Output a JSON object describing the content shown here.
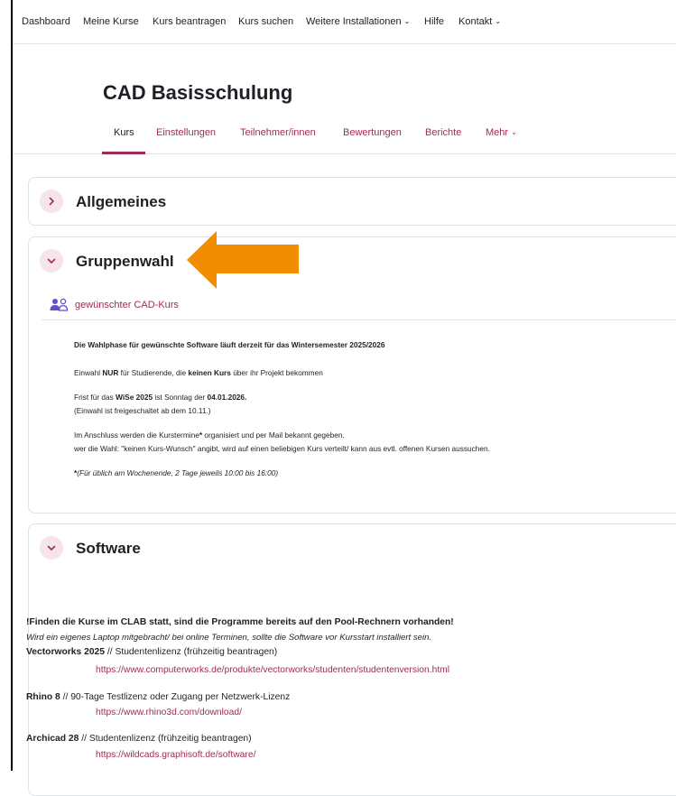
{
  "topnav": {
    "items": [
      "Dashboard",
      "Meine Kurse",
      "Kurs beantragen",
      "Kurs suchen",
      "Weitere Installationen",
      "Hilfe",
      "Kontakt"
    ]
  },
  "course": {
    "title": "CAD Basisschulung",
    "tabs": [
      "Kurs",
      "Einstellungen",
      "Teilnehmer/innen",
      "Bewertungen",
      "Berichte",
      "Mehr"
    ],
    "active_tab": "Kurs"
  },
  "sections": {
    "allgemeines": {
      "title": "Allgemeines",
      "state": "collapsed"
    },
    "gruppenwahl": {
      "title": "Gruppenwahl",
      "state": "expanded",
      "activity": {
        "label": "gewünschter CAD-Kurs",
        "icon": "group-choice-icon"
      },
      "heading": "Die Wahlphase für gewünschte Software läuft derzeit für das Wintersemester 2025/2026",
      "line1_a": "Einwahl ",
      "line1_b": "NUR",
      "line1_c": " für Studierende, die ",
      "line1_d": "keinen Kurs",
      "line1_e": " über ihr Projekt bekommen",
      "line2_a": "Frist für das ",
      "line2_b": "WiSe 2025",
      "line2_c": " ist Sonntag der ",
      "line2_d": "04.01.2026.",
      "line3": "(Einwahl ist freigeschaltet ab dem 10.11.)",
      "line4_a": "Im Anschluss werden die Kurstermine",
      "line4_b": "*",
      "line4_c": " organisiert und per Mail bekannt gegeben.",
      "line5": "wer die Wahl: \"keinen Kurs-Wunsch\" angibt, wird auf einen beliebigen Kurs verteilt/ kann aus evtl. offenen Kursen aussuchen.",
      "footnote_a": "*",
      "footnote_b": "(Für üblich am Wochenende, 2 Tage jeweils 10:00 bis 16:00)"
    },
    "software": {
      "title": "Software",
      "state": "expanded",
      "notice": "!Finden die Kurse im CLAB statt, sind die Programme bereits auf den Pool-Rechnern vorhanden!",
      "notice_italic": "Wird ein eigenes Laptop mitgebracht/ bei online Terminen, sollte die Software vor Kursstart installiert sein.",
      "items": [
        {
          "name": "Vectorworks 2025",
          "desc": " // Studentenlizenz (frühzeitig beantragen)",
          "url": "https://www.computerworks.de/produkte/vectorworks/studenten/studentenversion.html"
        },
        {
          "name": "Rhino 8",
          "desc": " // 90-Tage Testlizenz oder Zugang per Netzwerk-Lizenz",
          "url": "https://www.rhino3d.com/download/"
        },
        {
          "name": "Archicad 28",
          "desc": " // Studentenlizenz (frühzeitig beantragen)",
          "url": "https://wildcads.graphisoft.de/software/"
        }
      ]
    }
  },
  "colors": {
    "accent": "#a02b5b",
    "toggle_bg": "#f6e4ea",
    "arrow": "#f28c00",
    "icon": "#6a4cc9"
  }
}
